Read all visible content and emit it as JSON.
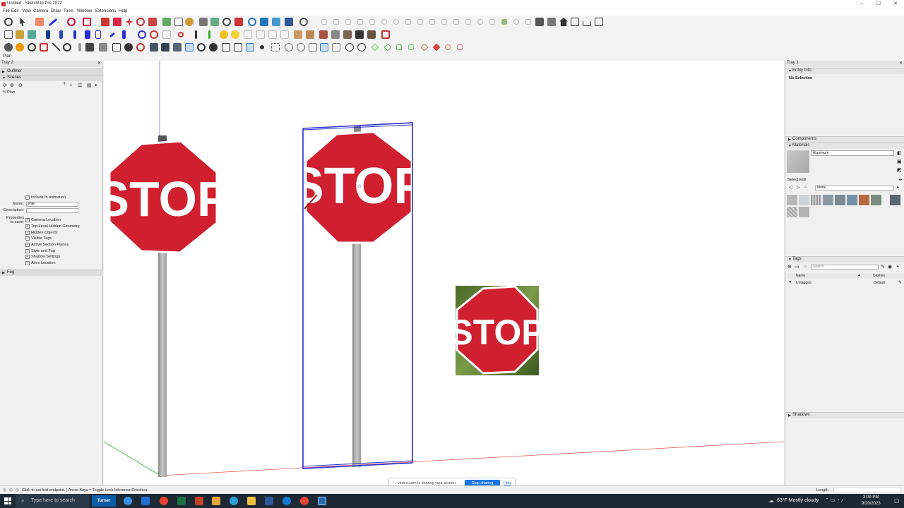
{
  "window": {
    "title": "Untitled - SketchUp Pro 2022",
    "min": "–",
    "max": "☐",
    "close": "✕"
  },
  "menu": [
    "File",
    "Edit",
    "View",
    "Camera",
    "Draw",
    "Tools",
    "Window",
    "Extensions",
    "Help"
  ],
  "scene_tab": "Plan",
  "tray2": {
    "title": "Tray 2",
    "outliner": "Outliner",
    "scenes": "Scenes",
    "scene_item": "Plan",
    "include_animation": "Include in animation",
    "name_label": "Name:",
    "name_value": "Plan",
    "description_label": "Description:",
    "properties_label_1": "Properties",
    "properties_label_2": "to save:",
    "properties": [
      "Camera Location",
      "Top-Level Hidden Geometry",
      "Hidden Objects",
      "Visible Tags",
      "Active Section Planes",
      "Style and Fog",
      "Shadow Settings",
      "Axes Location"
    ],
    "fog": "Fog"
  },
  "tray1": {
    "title": "Tray 1",
    "entity_info": "Entity Info",
    "no_selection": "No Selection",
    "components": "Components",
    "materials": "Materials",
    "material_name": "Aluminum",
    "select_tab": "Select",
    "edit_tab": "Edit",
    "library": "Metal",
    "tags": "Tags",
    "tags_search_placeholder": "Search",
    "tags_col_name": "Name",
    "tags_col_dashes": "Dashes",
    "tag_row_name": "Untagged",
    "tag_row_dashes": "Default",
    "shadows": "Shadows"
  },
  "viewport": {
    "sign_text": "STOP",
    "colors": {
      "sign_red": "#d01f2f",
      "sign_white": "#ffffff",
      "selection_blue": "#2b2fd0",
      "post_gray": "#a8a8a8"
    }
  },
  "status": {
    "hint": "Click to set first endpoint. | Arrow Keys = Toggle Lock Inference Direction",
    "measurement_label": "Length"
  },
  "share_bar": {
    "text": "vimeo.com is sharing your screen.",
    "stop_button": "Stop sharing",
    "hide_link": "Hide"
  },
  "taskbar": {
    "search_placeholder": "Type here to search",
    "turner": "Turner",
    "weather": "63°F  Mostly cloudy",
    "time": "3:09 PM",
    "date": "9/20/2023"
  }
}
